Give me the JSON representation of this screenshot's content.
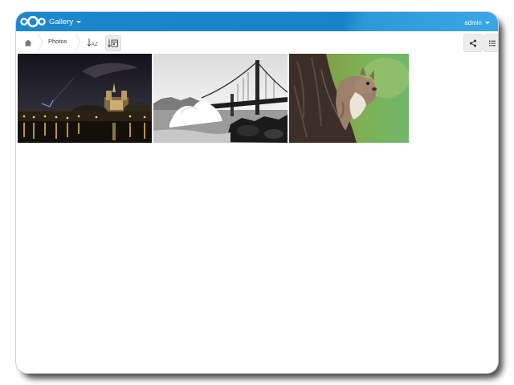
{
  "header": {
    "app_name": "Gallery",
    "user": "admin",
    "brand_color": "#1784c9"
  },
  "breadcrumb": {
    "home_icon": "home-icon",
    "current": "Photos"
  },
  "toolbar": {
    "sort_name_label": "AZ",
    "sort_date_icon": "calendar-icon",
    "share_icon": "share-icon",
    "info_icon": "details-icon"
  },
  "photos": [
    {
      "subject": "Notre-Dame cathedral at night"
    },
    {
      "subject": "Golden Gate Bridge, black and white"
    },
    {
      "subject": "Squirrel on tree trunk"
    }
  ]
}
